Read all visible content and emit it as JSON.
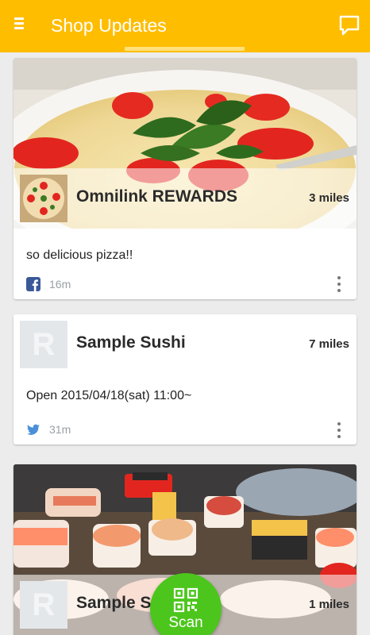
{
  "appbar": {
    "title": "Shop Updates",
    "menu_icon": "menu-icon",
    "chat_icon": "chat-bubble-icon",
    "color": "#ffbd00"
  },
  "posts": [
    {
      "shop_name": "Omnilink REWARDS",
      "distance": "3 miles",
      "message": "so delicious pizza!!",
      "source": "facebook",
      "time": "16m",
      "photo": "pizza"
    },
    {
      "shop_name": "Sample Sushi",
      "distance": "7 miles",
      "message": "Open 2015/04/18(sat) 11:00~",
      "source": "twitter",
      "time": "31m",
      "placeholder_letter": "R"
    },
    {
      "shop_name": "Sample S",
      "distance": "1 miles",
      "photo": "sushi",
      "placeholder_letter": "R"
    }
  ],
  "fab": {
    "label": "Scan",
    "icon": "qr-code-icon",
    "color": "#4cc61c"
  }
}
